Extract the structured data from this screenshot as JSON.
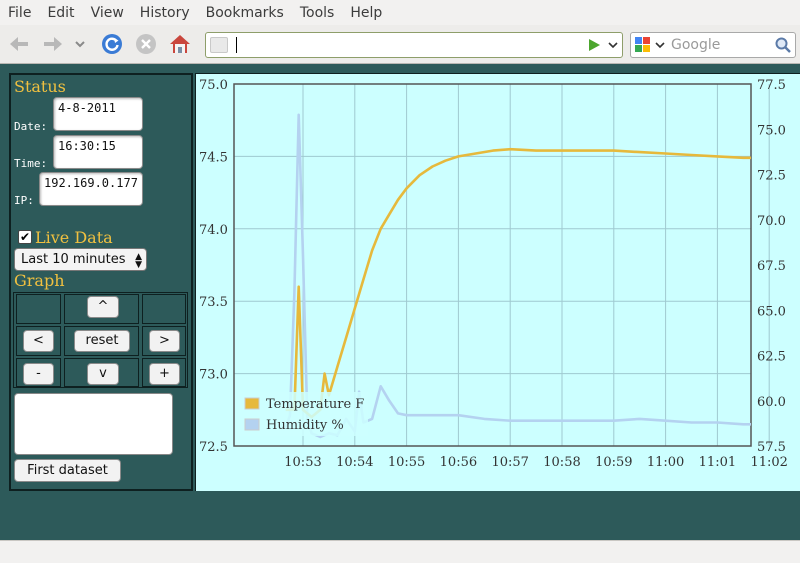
{
  "menu": [
    "File",
    "Edit",
    "View",
    "History",
    "Bookmarks",
    "Tools",
    "Help"
  ],
  "toolbar": {
    "url_value": "",
    "search_placeholder": "Google"
  },
  "status": {
    "title": "Status",
    "date_label": "Date:",
    "date_value": "4-8-2011",
    "time_label": "Time:",
    "time_value": "16:30:15",
    "ip_label": "IP:",
    "ip_value": "192.169.0.177"
  },
  "live": {
    "label": "Live Data",
    "checked": true,
    "range_selected": "Last 10 minutes"
  },
  "graph": {
    "title": "Graph",
    "up": "^",
    "left": "<",
    "reset": "reset",
    "right": ">",
    "minus": "-",
    "down": "v",
    "plus": "+"
  },
  "notes_value": "",
  "first_dataset_label": "First dataset",
  "colors": {
    "temperature": "#e6b93c",
    "humidity": "#b4d2f0",
    "plot_bg": "#ccffff",
    "accent": "#f0c040"
  },
  "chart_data": {
    "type": "line",
    "y_left": {
      "min": 72.5,
      "max": 75.0,
      "ticks": [
        "72.5",
        "73.0",
        "73.5",
        "74.0",
        "74.5",
        "75.0"
      ]
    },
    "y_right": {
      "min": 57.5,
      "max": 77.5,
      "ticks": [
        "57.5",
        "60.0",
        "62.5",
        "65.0",
        "67.5",
        "70.0",
        "72.5",
        "75.0",
        "77.5"
      ]
    },
    "x_ticks": [
      "10:53",
      "10:54",
      "10:55",
      "10:56",
      "10:57",
      "10:58",
      "10:59",
      "11:00",
      "11:01",
      "11:02"
    ],
    "legend_position": "bottom-left",
    "grid": true,
    "series": [
      {
        "name": "Temperature F",
        "axis": "left",
        "points": [
          [
            "10:52:40",
            72.75
          ],
          [
            "10:52:45",
            72.75
          ],
          [
            "10:52:50",
            72.75
          ],
          [
            "10:52:55",
            73.6
          ],
          [
            "10:53:00",
            72.75
          ],
          [
            "10:53:10",
            72.7
          ],
          [
            "10:53:20",
            72.75
          ],
          [
            "10:53:25",
            73.0
          ],
          [
            "10:53:30",
            72.85
          ],
          [
            "10:53:40",
            73.05
          ],
          [
            "10:53:50",
            73.25
          ],
          [
            "10:54:00",
            73.45
          ],
          [
            "10:54:10",
            73.65
          ],
          [
            "10:54:20",
            73.85
          ],
          [
            "10:54:30",
            74.0
          ],
          [
            "10:54:40",
            74.1
          ],
          [
            "10:54:50",
            74.2
          ],
          [
            "10:55:00",
            74.28
          ],
          [
            "10:55:15",
            74.37
          ],
          [
            "10:55:30",
            74.43
          ],
          [
            "10:55:45",
            74.47
          ],
          [
            "10:56:00",
            74.5
          ],
          [
            "10:56:20",
            74.52
          ],
          [
            "10:56:40",
            74.54
          ],
          [
            "10:57:00",
            74.55
          ],
          [
            "10:57:30",
            74.54
          ],
          [
            "10:58:00",
            74.54
          ],
          [
            "10:58:30",
            74.54
          ],
          [
            "10:59:00",
            74.54
          ],
          [
            "10:59:30",
            74.53
          ],
          [
            "11:00:00",
            74.52
          ],
          [
            "11:00:30",
            74.51
          ],
          [
            "11:01:00",
            74.5
          ],
          [
            "11:01:30",
            74.49
          ],
          [
            "11:02:00",
            74.49
          ],
          [
            "11:02:25",
            74.49
          ]
        ]
      },
      {
        "name": "Humidity %",
        "axis": "right",
        "points": [
          [
            "10:52:40",
            58.5
          ],
          [
            "10:52:45",
            59.2
          ],
          [
            "10:52:50",
            66.0
          ],
          [
            "10:52:55",
            75.8
          ],
          [
            "10:53:00",
            68.0
          ],
          [
            "10:53:05",
            59.0
          ],
          [
            "10:53:10",
            58.2
          ],
          [
            "10:53:20",
            58.0
          ],
          [
            "10:53:30",
            58.2
          ],
          [
            "10:53:40",
            58.1
          ],
          [
            "10:53:50",
            59.0
          ],
          [
            "10:54:00",
            58.3
          ],
          [
            "10:54:05",
            60.5
          ],
          [
            "10:54:10",
            58.8
          ],
          [
            "10:54:20",
            59.0
          ],
          [
            "10:54:30",
            60.8
          ],
          [
            "10:54:40",
            60.0
          ],
          [
            "10:54:50",
            59.3
          ],
          [
            "10:55:00",
            59.2
          ],
          [
            "10:55:30",
            59.2
          ],
          [
            "10:56:00",
            59.2
          ],
          [
            "10:56:30",
            59.0
          ],
          [
            "10:57:00",
            58.9
          ],
          [
            "10:57:30",
            58.9
          ],
          [
            "10:58:00",
            58.9
          ],
          [
            "10:58:30",
            58.9
          ],
          [
            "10:59:00",
            58.9
          ],
          [
            "10:59:30",
            59.0
          ],
          [
            "11:00:00",
            58.9
          ],
          [
            "11:00:30",
            58.8
          ],
          [
            "11:01:00",
            58.8
          ],
          [
            "11:01:30",
            58.7
          ],
          [
            "11:02:00",
            58.7
          ],
          [
            "11:02:25",
            58.7
          ]
        ]
      }
    ]
  }
}
